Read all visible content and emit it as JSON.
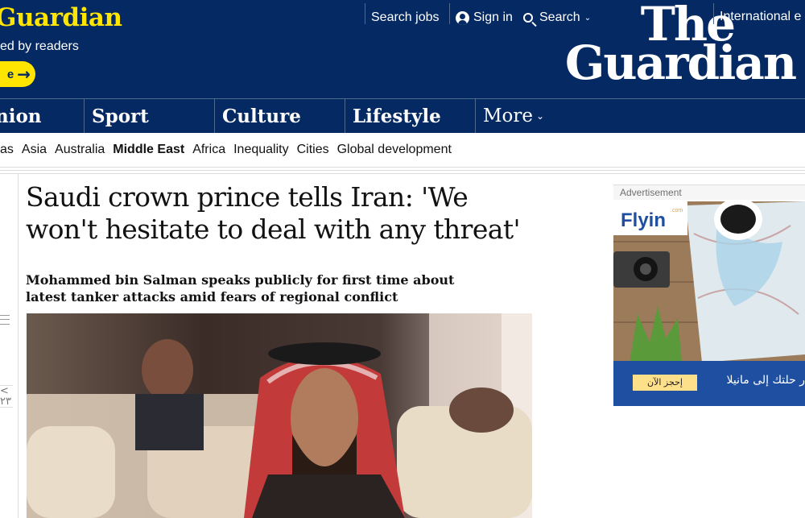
{
  "promo": {
    "title": "Guardian",
    "subtitle": "ed by readers",
    "button_label": "e",
    "button_arrow": "→"
  },
  "top_links": {
    "search_jobs": "Search jobs",
    "sign_in": "Sign in",
    "search": "Search",
    "search_chevron": "⌄"
  },
  "logo": {
    "line1": "The",
    "line2": "Guardian"
  },
  "edition": "International e",
  "nav": {
    "items": [
      "nion",
      "Sport",
      "Culture",
      "Lifestyle",
      "More"
    ],
    "more_chevron": "⌄"
  },
  "subnav": {
    "items": [
      "as",
      "Asia",
      "Australia",
      "Middle East",
      "Africa",
      "Inequality",
      "Cities",
      "Global development"
    ],
    "active": "Middle East"
  },
  "article": {
    "headline": "Saudi crown prince tells Iran: 'We won't hesitate to deal with any threat'",
    "standfirst": "Mohammed bin Salman speaks publicly for first time about latest tanker attacks amid fears of regional conflict"
  },
  "left_rail": {
    "share_glyph": "<",
    "share_count": "۲۳"
  },
  "advertisement": {
    "label": "Advertisement",
    "brand": "Flyin",
    "brand_suffix": ".com",
    "cta": "إحجز الآن",
    "tagline": "ر حلتك إلى مانيلا"
  },
  "colors": {
    "brand_blue": "#052962",
    "highlight_yellow": "#ffe500",
    "ad_blue": "#1f4fa0"
  }
}
